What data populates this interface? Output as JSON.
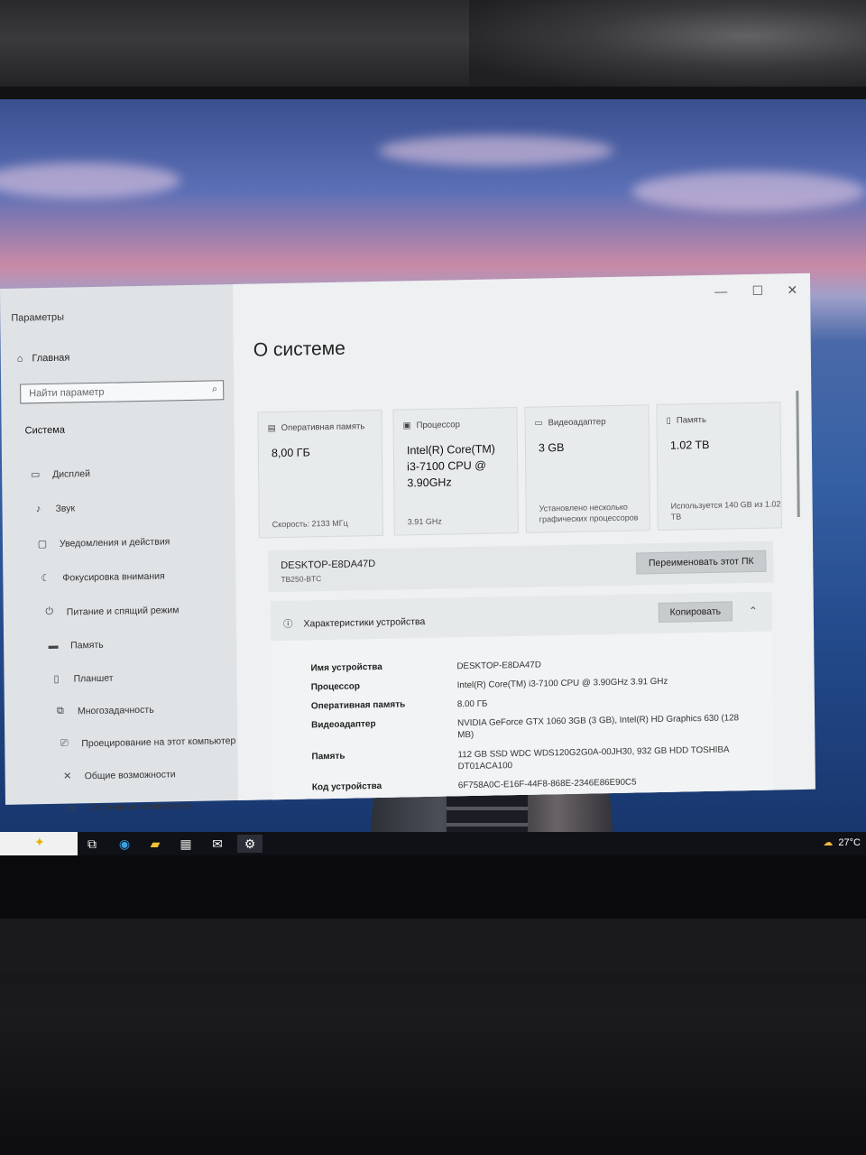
{
  "window": {
    "app_title": "Параметры",
    "controls": {
      "minimize": "—",
      "maximize": "☐",
      "close": "✕"
    }
  },
  "sidebar": {
    "home_label": "Главная",
    "search_placeholder": "Найти параметр",
    "section_title": "Система",
    "items": [
      {
        "label": "Дисплей",
        "icon": "display-icon"
      },
      {
        "label": "Звук",
        "icon": "sound-icon"
      },
      {
        "label": "Уведомления и действия",
        "icon": "notifications-icon"
      },
      {
        "label": "Фокусировка внимания",
        "icon": "focus-assist-icon"
      },
      {
        "label": "Питание и спящий режим",
        "icon": "power-icon"
      },
      {
        "label": "Память",
        "icon": "storage-icon"
      },
      {
        "label": "Планшет",
        "icon": "tablet-icon"
      },
      {
        "label": "Многозадачность",
        "icon": "multitasking-icon"
      },
      {
        "label": "Проецирование на этот компьютер",
        "icon": "projecting-icon"
      },
      {
        "label": "Общие возможности",
        "icon": "shared-experiences-icon"
      },
      {
        "label": "Системные компоненты",
        "icon": "system-components-icon"
      }
    ]
  },
  "main": {
    "page_title": "О системе",
    "cards": [
      {
        "header": "Оперативная память",
        "value": "8,00 ГБ",
        "footer": "Скорость: 2133 МГц",
        "icon": "ram-icon"
      },
      {
        "header": "Процессор",
        "value": "Intel(R) Core(TM) i3-7100 CPU @ 3.90GHz",
        "footer": "3.91 GHz",
        "icon": "cpu-icon"
      },
      {
        "header": "Видеоадаптер",
        "value": "3 GB",
        "footer": "Установлено несколько графических процессоров",
        "icon": "gpu-icon"
      },
      {
        "header": "Память",
        "value": "1.02 TB",
        "footer": "Используется 140 GB из 1.02 TB",
        "icon": "storage-icon"
      }
    ],
    "pc": {
      "name": "DESKTOP-E8DA47D",
      "model": "TB250-BTC",
      "rename_button": "Переименовать этот ПК"
    },
    "specs": {
      "header": "Характеристики устройства",
      "copy_button": "Копировать",
      "rows": [
        {
          "label": "Имя устройства",
          "value": "DESKTOP-E8DA47D"
        },
        {
          "label": "Процессор",
          "value": "Intel(R) Core(TM) i3-7100 CPU @ 3.90GHz   3.91 GHz"
        },
        {
          "label": "Оперативная память",
          "value": "8.00 ГБ"
        },
        {
          "label": "Видеоадаптер",
          "value": "NVIDIA GeForce GTX 1060 3GB (3 GB), Intel(R) HD Graphics 630 (128 MB)"
        },
        {
          "label": "Память",
          "value": "112 GB SSD WDC WDS120G2G0A-00JH30, 932 GB HDD TOSHIBA DT01ACA100"
        },
        {
          "label": "Код устройства",
          "value": "6F758A0C-E16F-44F8-868E-2346E86E90C5"
        }
      ]
    }
  },
  "taskbar": {
    "icons": [
      "task-view-icon",
      "edge-icon",
      "file-explorer-icon",
      "store-icon",
      "mail-icon",
      "settings-icon"
    ],
    "weather_temp": "27°C"
  }
}
